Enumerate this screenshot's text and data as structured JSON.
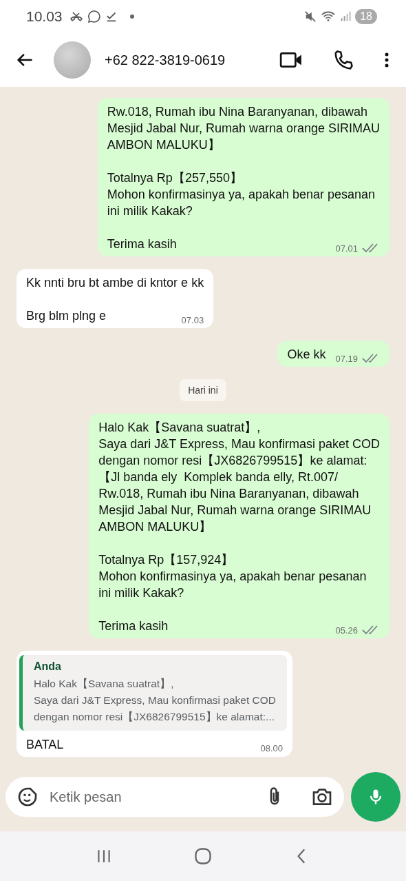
{
  "status_bar": {
    "time": "10.03",
    "battery": "18"
  },
  "header": {
    "contact": "+62 822-3819-0619"
  },
  "messages": [
    {
      "kind": "out",
      "paragraphs": [
        "Rw.018, Rumah ibu Nina Baranyanan, dibawah\nMesjid Jabal Nur, Rumah warna orange SIRIMAU\nAMBON MALUKU】",
        "Totalnya Rp【257,550】\nMohon konfirmasinya ya, apakah benar pesanan\nini milik Kakak?",
        "Terima kasih"
      ],
      "time": "07.01",
      "delivered": true
    },
    {
      "kind": "in",
      "paragraphs": [
        "Kk nnti bru bt ambe di kntor e kk",
        "Brg blm plng e"
      ],
      "time": "07.03"
    },
    {
      "kind": "out",
      "paragraphs": [
        "Oke kk"
      ],
      "time": "07.19",
      "delivered": true
    },
    {
      "kind": "date",
      "text": "Hari ini"
    },
    {
      "kind": "out",
      "paragraphs": [
        "Halo Kak【Savana suatrat】,\nSaya dari J&T Express, Mau konfirmasi paket COD\ndengan nomor resi【JX6826799515】ke alamat:\n【Jl banda ely  Komplek banda elly, Rt.007/\nRw.018, Rumah ibu Nina Baranyanan, dibawah\nMesjid Jabal Nur, Rumah warna orange SIRIMAU\nAMBON MALUKU】",
        "Totalnya Rp【157,924】\nMohon konfirmasinya ya, apakah benar pesanan\nini milik Kakak?",
        "Terima kasih"
      ],
      "time": "05.26",
      "delivered": true
    },
    {
      "kind": "reply",
      "quote_author": "Anda",
      "quote_text": "Halo Kak【Savana suatrat】,\nSaya dari J&T Express, Mau konfirmasi paket COD\ndengan nomor resi【JX6826799515】ke alamat:...",
      "paragraphs": [
        "BATAL"
      ],
      "time": "08.00"
    }
  ],
  "composer": {
    "placeholder": "Ketik pesan"
  }
}
